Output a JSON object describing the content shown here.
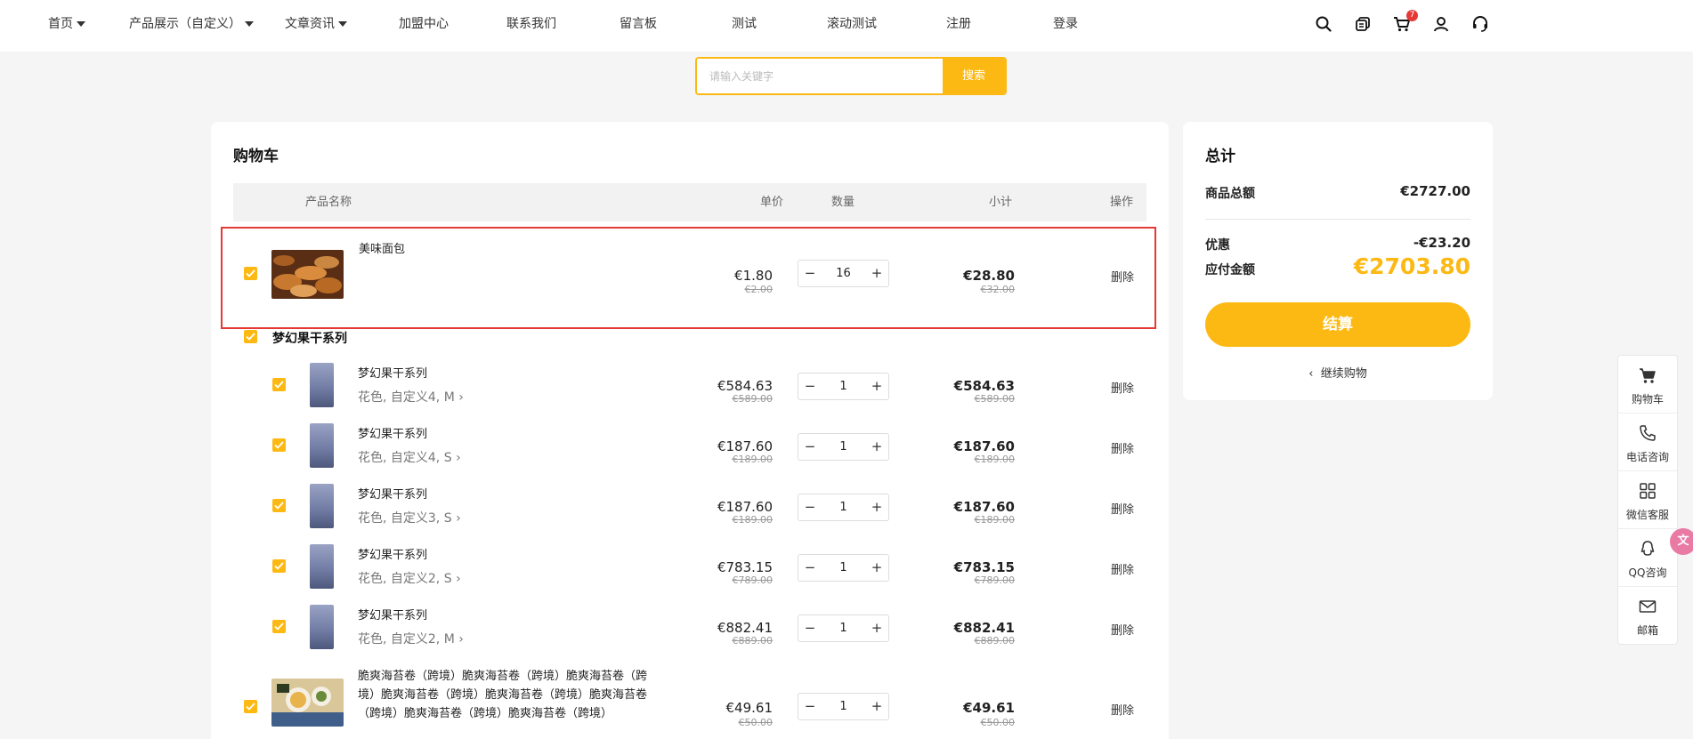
{
  "nav": {
    "items": [
      {
        "label": "首页",
        "has_caret": true
      },
      {
        "label": "产品展示（自定义）",
        "has_caret": true
      },
      {
        "label": "文章资讯",
        "has_caret": true
      },
      {
        "label": "加盟中心"
      },
      {
        "label": "联系我们"
      },
      {
        "label": "留言板"
      },
      {
        "label": "测试"
      },
      {
        "label": "滚动测试"
      },
      {
        "label": "注册"
      },
      {
        "label": "登录"
      }
    ],
    "icons": [
      "search-icon",
      "layers-icon",
      "cart-icon",
      "user-icon",
      "headset-icon"
    ],
    "cart_count": "7"
  },
  "search": {
    "placeholder": "请输入关键字",
    "button": "搜索"
  },
  "cart": {
    "title": "购物车",
    "columns": {
      "name": "产品名称",
      "price": "单价",
      "qty": "数量",
      "subtotal": "小计",
      "action": "操作"
    },
    "items": [
      {
        "name": "美味面包",
        "price": "€1.80",
        "original_price": "€2.00",
        "qty": "16",
        "subtotal": "€28.80",
        "original_subtotal": "€32.00",
        "action": "删除",
        "checked": true,
        "highlighted": true
      }
    ],
    "group": {
      "title": "梦幻果干系列",
      "items": [
        {
          "name": "梦幻果干系列",
          "spec": "花色, 自定义4, M",
          "price": "€584.63",
          "original_price": "€589.00",
          "qty": "1",
          "subtotal": "€584.63",
          "original_subtotal": "€589.00",
          "action": "删除"
        },
        {
          "name": "梦幻果干系列",
          "spec": "花色, 自定义4, S",
          "price": "€187.60",
          "original_price": "€189.00",
          "qty": "1",
          "subtotal": "€187.60",
          "original_subtotal": "€189.00",
          "action": "删除"
        },
        {
          "name": "梦幻果干系列",
          "spec": "花色, 自定义3, S",
          "price": "€187.60",
          "original_price": "€189.00",
          "qty": "1",
          "subtotal": "€187.60",
          "original_subtotal": "€189.00",
          "action": "删除"
        },
        {
          "name": "梦幻果干系列",
          "spec": "花色, 自定义2, S",
          "price": "€783.15",
          "original_price": "€789.00",
          "qty": "1",
          "subtotal": "€783.15",
          "original_subtotal": "€789.00",
          "action": "删除"
        },
        {
          "name": "梦幻果干系列",
          "spec": "花色, 自定义2, M",
          "price": "€882.41",
          "original_price": "€889.00",
          "qty": "1",
          "subtotal": "€882.41",
          "original_subtotal": "€889.00",
          "action": "删除"
        }
      ]
    },
    "last_item": {
      "name": "脆爽海苔卷（跨境）脆爽海苔卷（跨境）脆爽海苔卷（跨境）脆爽海苔卷（跨境）脆爽海苔卷（跨境）脆爽海苔卷（跨境）脆爽海苔卷（跨境）脆爽海苔卷（跨境）",
      "price": "€49.61",
      "original_price": "€50.00",
      "qty": "1",
      "subtotal": "€49.61",
      "original_subtotal": "€50.00",
      "action": "删除"
    }
  },
  "summary": {
    "title": "总计",
    "goods_label": "商品总额",
    "goods_value": "€2727.00",
    "discount_label": "优惠",
    "discount_value": "-€23.20",
    "payable_label": "应付金额",
    "payable_value": "€2703.80",
    "checkout": "结算",
    "continue": "继续购物"
  },
  "float_bar": [
    {
      "label": "购物车",
      "icon": "cart-icon"
    },
    {
      "label": "电话咨询",
      "icon": "phone-icon"
    },
    {
      "label": "微信客服",
      "icon": "grid-icon"
    },
    {
      "label": "QQ咨询",
      "icon": "qq-icon"
    },
    {
      "label": "邮箱",
      "icon": "mail-icon"
    }
  ],
  "colors": {
    "accent": "#fdb913",
    "highlight": "#e53935"
  }
}
